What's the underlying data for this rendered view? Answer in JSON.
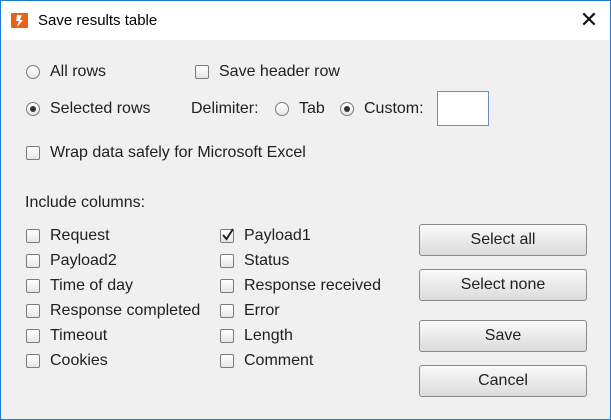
{
  "window": {
    "title": "Save results table",
    "close_glyph": "✕",
    "icon": "burp-suite-icon",
    "accent": "#1f7ad4"
  },
  "rows": {
    "all_rows": "All rows",
    "selected_rows": "Selected rows",
    "selected": "selected_rows"
  },
  "options": {
    "save_header_row": "Save header row",
    "save_header_checked": false,
    "wrap_excel": "Wrap data safely for Microsoft Excel",
    "wrap_excel_checked": false
  },
  "delimiter": {
    "label": "Delimiter:",
    "tab": "Tab",
    "custom": "Custom:",
    "selected": "custom",
    "custom_value": ""
  },
  "columns": {
    "heading": "Include columns:",
    "left": [
      {
        "label": "Request",
        "checked": false
      },
      {
        "label": "Payload2",
        "checked": false
      },
      {
        "label": "Time of day",
        "checked": false
      },
      {
        "label": "Response completed",
        "checked": false
      },
      {
        "label": "Timeout",
        "checked": false
      },
      {
        "label": "Cookies",
        "checked": false
      }
    ],
    "right": [
      {
        "label": "Payload1",
        "checked": true
      },
      {
        "label": "Status",
        "checked": false
      },
      {
        "label": "Response received",
        "checked": false
      },
      {
        "label": "Error",
        "checked": false
      },
      {
        "label": "Length",
        "checked": false
      },
      {
        "label": "Comment",
        "checked": false
      }
    ]
  },
  "buttons": {
    "select_all": "Select all",
    "select_none": "Select none",
    "save": "Save",
    "cancel": "Cancel"
  }
}
